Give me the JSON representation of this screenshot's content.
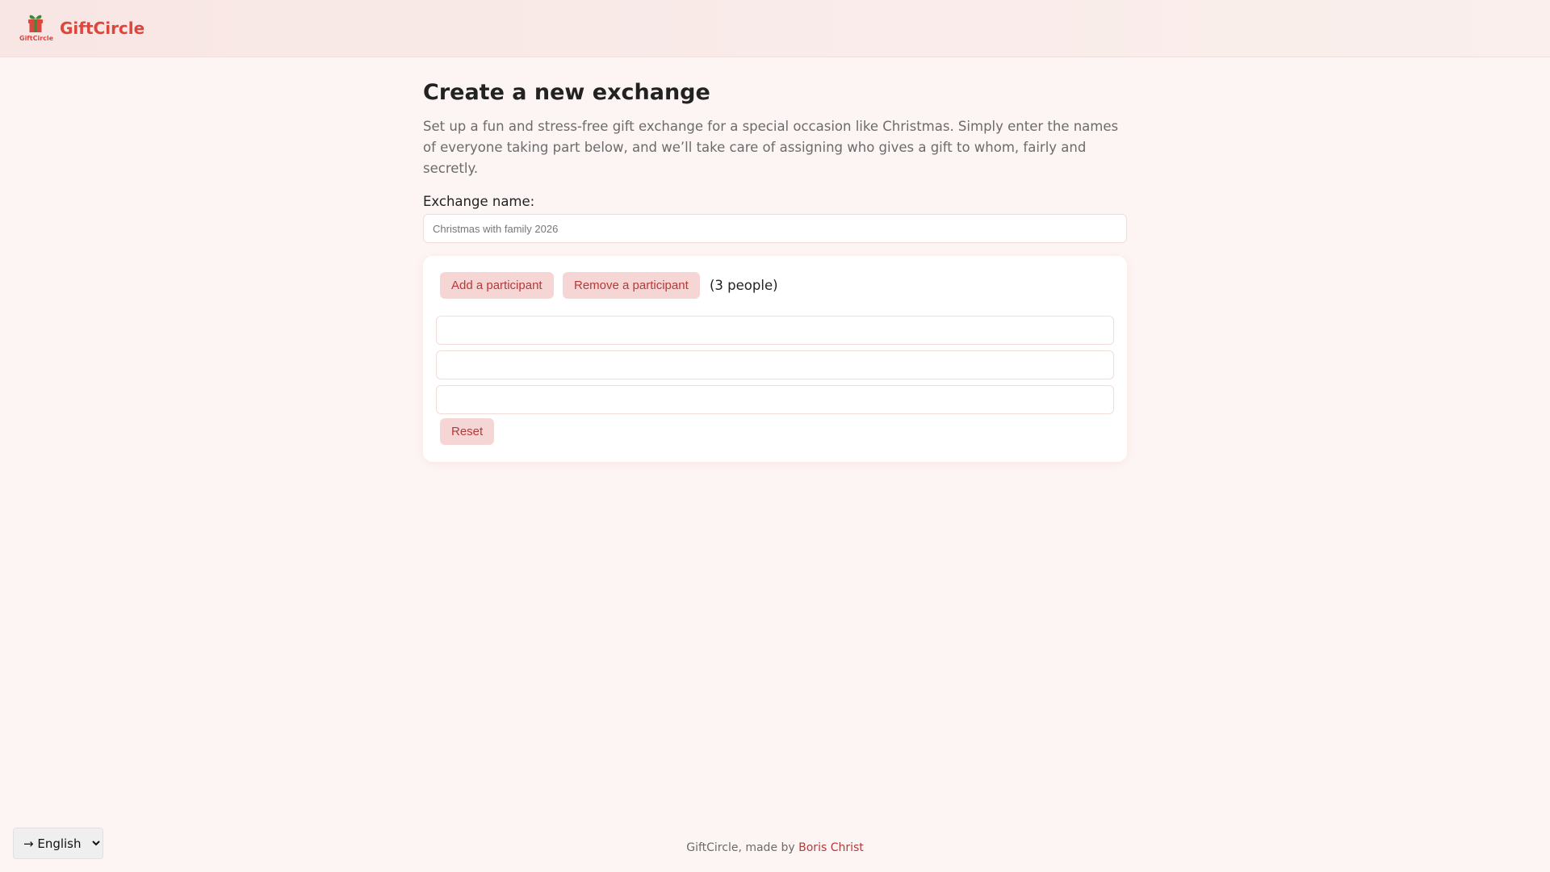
{
  "header": {
    "brand": "GiftCircle",
    "logo_text": "GiftCircle",
    "logo_icon": "gift-icon",
    "brand_color": "#e0453b"
  },
  "main": {
    "title": "Create a new exchange",
    "intro": "Set up a fun and stress-free gift exchange for a special occasion like Christmas. Simply enter the names of everyone taking part below, and we’ll take care of assigning who gives a gift to whom, fairly and secretly.",
    "exchange_name_label": "Exchange name:",
    "exchange_name_placeholder": "Christmas with family 2026",
    "exchange_name_value": ""
  },
  "participants": {
    "add_label": "Add a participant",
    "remove_label": "Remove a participant",
    "count_text": "(3 people)",
    "items": [
      {
        "value": ""
      },
      {
        "value": ""
      },
      {
        "value": ""
      }
    ],
    "reset_label": "Reset"
  },
  "footer": {
    "prefix": "GiftCircle, made by ",
    "author": "Boris Christ"
  },
  "language": {
    "selected": "→ English"
  },
  "colors": {
    "accent": "#b33a3a",
    "button_bg": "#f6d6d5",
    "page_bg": "#fdf5f4"
  }
}
